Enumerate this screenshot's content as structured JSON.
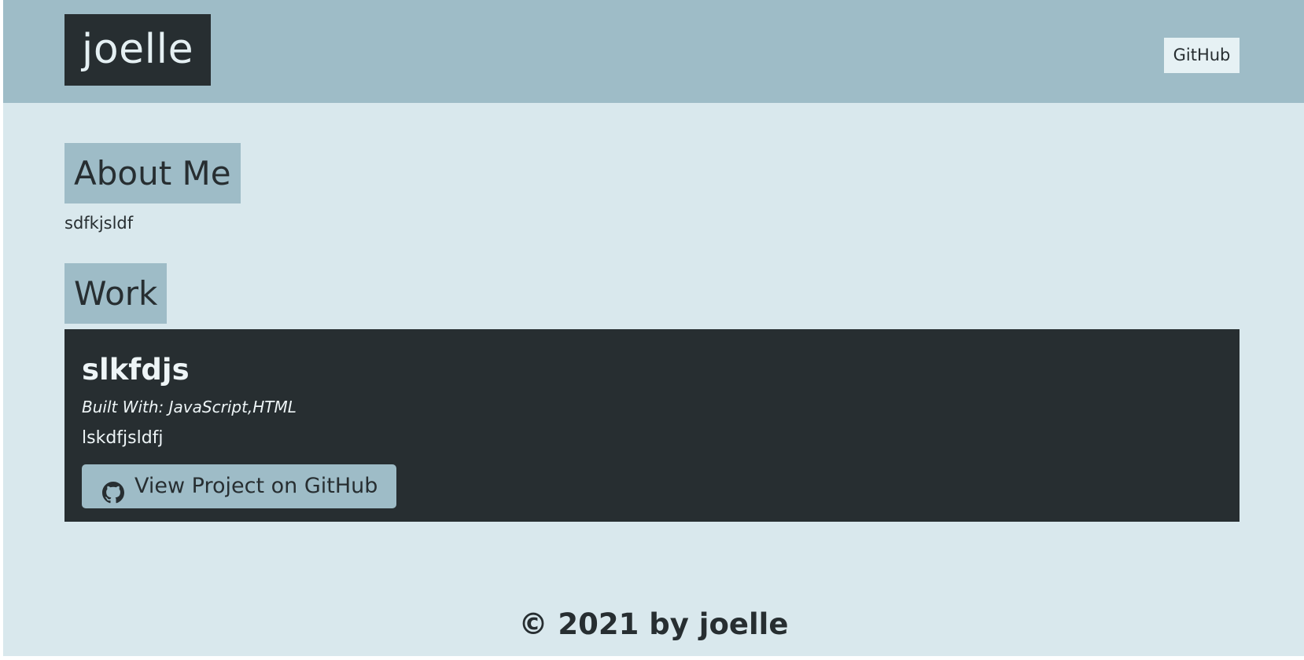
{
  "header": {
    "brand": "joelle",
    "nav_github": "GitHub"
  },
  "about": {
    "title": "About Me",
    "text": "sdfkjsldf"
  },
  "work": {
    "title": "Work",
    "projects": [
      {
        "name": "slkfdjs",
        "built_with": "Built With: JavaScript,HTML",
        "description": "lskdfjsldfj",
        "button_label": "View Project on GitHub",
        "button_icon": "github-icon"
      }
    ]
  },
  "footer": {
    "text": "© 2021 by joelle"
  },
  "colors": {
    "header_bg": "#9ebcc7",
    "page_bg": "#d9e8ed",
    "dark": "#272e31",
    "light_text": "#e5f0f3"
  }
}
